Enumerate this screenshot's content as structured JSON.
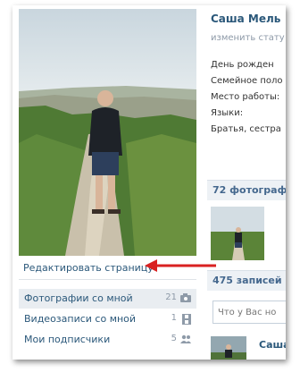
{
  "profile": {
    "name": "Саша Мель",
    "status_link": "изменить стату",
    "info_rows": [
      "День рожден",
      "Семейное поло",
      "Место работы:",
      "Языки:",
      "Братья, сестра"
    ]
  },
  "left": {
    "edit_link": "Редактировать страницу",
    "menu": [
      {
        "label": "Фотографии со мной",
        "count": "21",
        "icon": "camera-icon"
      },
      {
        "label": "Видеозаписи со мной",
        "count": "1",
        "icon": "film-icon"
      },
      {
        "label": "Мои подписчики",
        "count": "5",
        "icon": "users-icon"
      }
    ]
  },
  "right": {
    "photos_header": "72 фотограф",
    "posts_header": "475 записей",
    "post_input_placeholder": "Что у Вас но",
    "post_author": "Саша"
  },
  "colors": {
    "link": "#2b587a",
    "section_bg": "#edf1f5",
    "arrow": "#d92121"
  }
}
